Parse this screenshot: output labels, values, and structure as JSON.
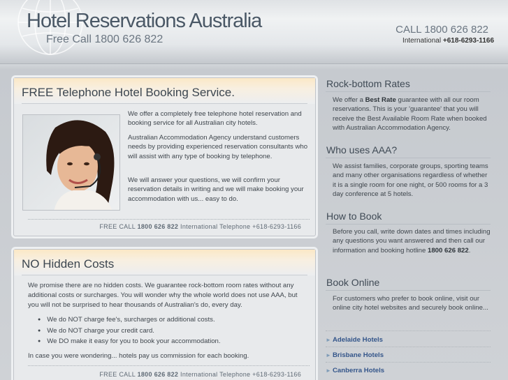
{
  "header": {
    "title": "Hotel Reservations Australia",
    "subtitle": "Free Call 1800 626 822",
    "call": "CALL 1800 626 822",
    "intl_label": "International",
    "intl_number": "+618-6293-1166"
  },
  "panel1": {
    "heading": "FREE Telephone Hotel Booking Service.",
    "para1": "We offer a completely free telephone hotel reservation and booking service for all Australian city hotels.",
    "para2": "Australian Accommodation Agency understand customers needs by providing experienced reservation consultants who will assist with any type of booking by telephone.",
    "para3": "We will answer your questions, we will confirm your reservation details in writing and we will make booking your accommodation with us... easy to do.",
    "footer": {
      "freecall_label": "FREE CALL",
      "freecall_number": "1800 626 822",
      "intl_label": "International Telephone",
      "intl_number": "+618-6293-1166"
    }
  },
  "panel2": {
    "heading": "NO Hidden Costs",
    "intro": "We promise there are no hidden costs.  We guarantee rock-bottom room rates without any additional costs or surcharges.  You will wonder why the whole world does not use AAA, but you will not be surprised to hear thousands of Australian's do, every day.",
    "bullets": [
      "We do NOT charge fee's, surcharges or additional costs.",
      "We do NOT charge your credit card.",
      "We DO make it easy for you to book your accommodation."
    ],
    "outro": "In case you were wondering... hotels pay us commission for each booking.",
    "footer": {
      "freecall_label": "FREE CALL",
      "freecall_number": "1800 626 822",
      "intl_label": "International Telephone",
      "intl_number": "+618-6293-1166"
    }
  },
  "sidebar": {
    "rates": {
      "heading": "Rock-bottom Rates",
      "pre": "We offer a ",
      "bold": "Best Rate",
      "post": " guarantee with all our room reservations.  This is your 'guarantee' that you will receive the Best Available Room Rate when booked with Australian Accommodation Agency."
    },
    "who": {
      "heading": "Who uses AAA?",
      "text": "We assist families, corporate groups, sporting teams and many other organisations regardless of whether it is a single room for one night, or 500 rooms for a 3 day conference at 5 hotels."
    },
    "how": {
      "heading": "How to Book",
      "pre": "Before you call, write down dates and times including any questions you want answered and then call our information and booking hotline ",
      "bold": "1800 626 822",
      "post": "."
    },
    "online": {
      "heading": "Book Online",
      "text": "For customers who prefer to book online, visit our online city hotel websites and securely book online...",
      "links": [
        "Adelaide Hotels",
        "Brisbane Hotels",
        "Canberra Hotels"
      ]
    }
  }
}
